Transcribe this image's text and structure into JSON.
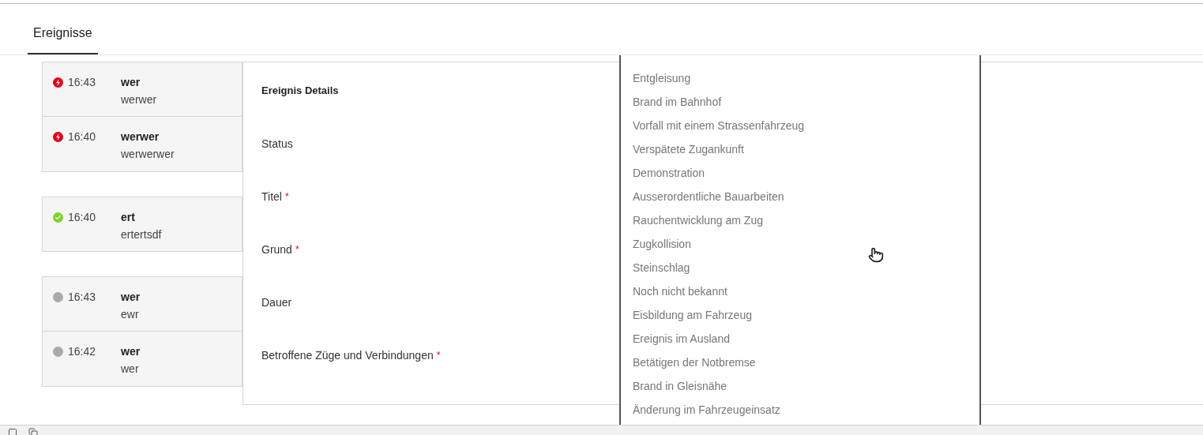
{
  "tabs": [
    {
      "label": "Ereignisse",
      "selected": true
    }
  ],
  "event_groups": [
    {
      "events": [
        {
          "kind": "alert",
          "color": "#e2001a",
          "time": "16:43",
          "title": "wer",
          "description": "werwer"
        },
        {
          "kind": "alert",
          "color": "#e2001a",
          "time": "16:40",
          "title": "werwer",
          "description": "werwerwer"
        }
      ]
    },
    {
      "events": [
        {
          "kind": "done",
          "color": "#7ed321",
          "time": "16:40",
          "title": "ert",
          "description": "ertertsdf"
        }
      ]
    },
    {
      "events": [
        {
          "kind": "pending",
          "color": "#aaaaaa",
          "time": "16:43",
          "title": "wer",
          "description": "ewr"
        },
        {
          "kind": "pending",
          "color": "#aaaaaa",
          "time": "16:42",
          "title": "wer",
          "description": "wer"
        }
      ]
    }
  ],
  "details": {
    "title": "Ereignis Details",
    "fields": [
      {
        "label": "Status"
      },
      {
        "label": "Titel",
        "required_mark": "*"
      },
      {
        "label": "Grund",
        "required_mark": "*"
      },
      {
        "label": "Dauer"
      },
      {
        "label": "Betroffene Züge und Verbindungen",
        "required_mark": "*"
      }
    ]
  },
  "dropdown": {
    "options": [
      "Entgleisung",
      "Brand im Bahnhof",
      "Vorfall mit einem Strassenfahrzeug",
      "Verspätete Zugankunft",
      "Demonstration",
      "Ausserordentliche Bauarbeiten",
      "Rauchentwicklung am Zug",
      "Zugkollision",
      "Steinschlag",
      "Noch nicht bekannt",
      "Eisbildung am Fahrzeug",
      "Ereignis im Ausland",
      "Betätigen der Notbremse",
      "Brand in Gleisnähe",
      "Änderung im Fahrzeugeinsatz"
    ]
  }
}
